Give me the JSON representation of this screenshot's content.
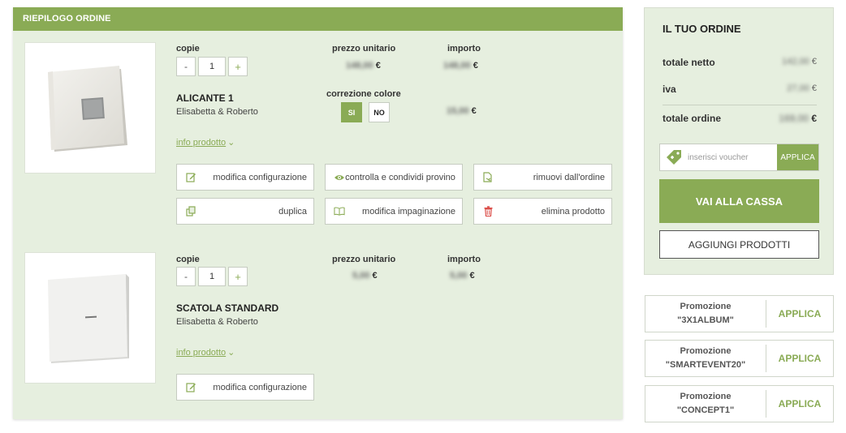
{
  "order": {
    "header": "RIEPILOGO ORDINE",
    "products": [
      {
        "copies_label": "copie",
        "unit_price_label": "prezzo unitario",
        "amount_label": "importo",
        "qty_minus": "-",
        "qty": "1",
        "qty_plus": "+",
        "unit_price": "148,00",
        "amount": "148,00",
        "currency": "€",
        "name": "ALICANTE 1",
        "subtitle": "Elisabetta & Roberto",
        "color_correction_label": "correzione colore",
        "color_correction_yes": "SI",
        "color_correction_no": "NO",
        "color_correction_amount": "15,00",
        "info_link": "info prodotto",
        "actions": [
          {
            "label": "modifica configurazione",
            "icon": "edit-icon"
          },
          {
            "label": "controlla e condividi provino",
            "icon": "eye-icon"
          },
          {
            "label": "rimuovi dall'ordine",
            "icon": "remove-doc-icon"
          },
          {
            "label": "duplica",
            "icon": "duplicate-icon"
          },
          {
            "label": "modifica impaginazione",
            "icon": "book-icon"
          },
          {
            "label": "elimina prodotto",
            "icon": "trash-icon"
          }
        ]
      },
      {
        "copies_label": "copie",
        "unit_price_label": "prezzo unitario",
        "amount_label": "importo",
        "qty_minus": "-",
        "qty": "1",
        "qty_plus": "+",
        "unit_price": "5,00",
        "amount": "5,00",
        "currency": "€",
        "name": "SCATOLA STANDARD",
        "subtitle": "Elisabetta & Roberto",
        "info_link": "info prodotto",
        "actions": [
          {
            "label": "modifica configurazione",
            "icon": "edit-icon"
          }
        ]
      }
    ]
  },
  "summary": {
    "title": "IL TUO ORDINE",
    "net_label": "totale netto",
    "net_value": "142,00",
    "vat_label": "iva",
    "vat_value": "27,00",
    "total_label": "totale ordine",
    "total_value": "169,00",
    "currency": "€",
    "voucher_placeholder": "inserisci voucher",
    "voucher_apply": "APPLICA",
    "checkout": "VAI ALLA CASSA",
    "add_products": "AGGIUNGI PRODOTTI"
  },
  "promotions": [
    {
      "label": "Promozione",
      "code": "\"3X1ALBUM\"",
      "apply": "APPLICA"
    },
    {
      "label": "Promozione",
      "code": "\"SMARTEVENT20\"",
      "apply": "APPLICA"
    },
    {
      "label": "Promozione",
      "code": "\"CONCEPT1\"",
      "apply": "APPLICA"
    }
  ],
  "colors": {
    "accent": "#8aab55",
    "panel": "#e6efdf",
    "delete": "#d9443f"
  }
}
